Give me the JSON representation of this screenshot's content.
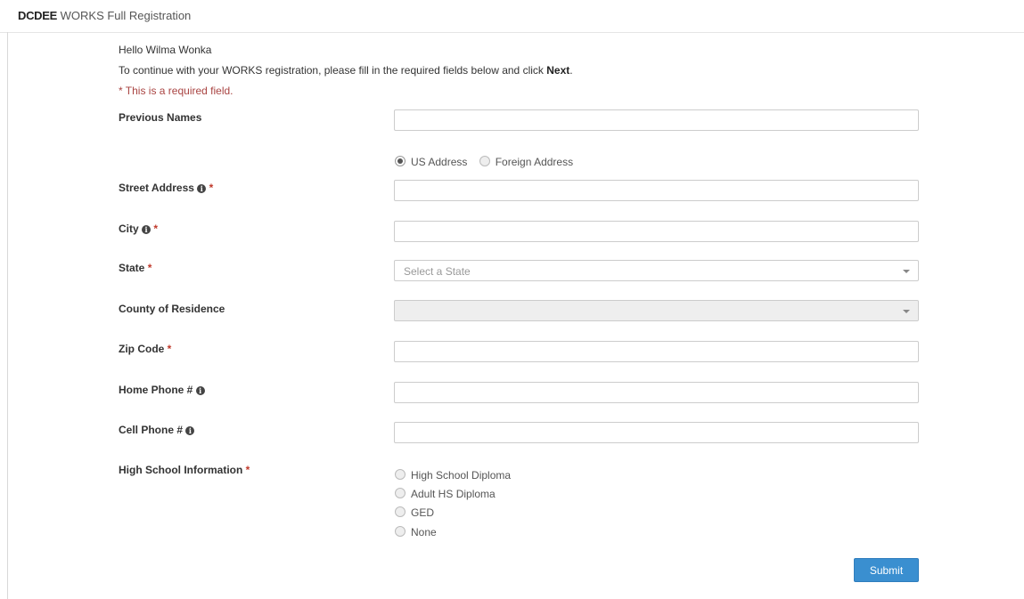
{
  "header": {
    "brand": "DCDEE",
    "title_rest": " WORKS Full Registration"
  },
  "intro": {
    "greeting": "Hello Wilma Wonka",
    "instructions_prefix": "To continue with your WORKS registration, please fill in the required fields below and click ",
    "instructions_bold": "Next",
    "instructions_suffix": ".",
    "required_note": "* This is a required field."
  },
  "fields": {
    "previous_names": {
      "label": "Previous Names",
      "value": ""
    },
    "address_type": {
      "options": [
        "US Address",
        "Foreign Address"
      ],
      "selected": "US Address"
    },
    "street_address": {
      "label": "Street Address",
      "value": ""
    },
    "city": {
      "label": "City",
      "value": ""
    },
    "state": {
      "label": "State",
      "placeholder": "Select a State"
    },
    "county": {
      "label": "County of Residence",
      "value": ""
    },
    "zip": {
      "label": "Zip Code",
      "value": ""
    },
    "home_phone": {
      "label": "Home Phone #",
      "value": ""
    },
    "cell_phone": {
      "label": "Cell Phone #",
      "value": ""
    },
    "high_school": {
      "label": "High School Information",
      "options": [
        "High School Diploma",
        "Adult HS Diploma",
        "GED",
        "None"
      ],
      "selected": null
    }
  },
  "required_marker": "*",
  "info_icon_glyph": "i",
  "submit_label": "Submit",
  "colors": {
    "required": "#c0392b",
    "required_note": "#a94442",
    "primary_button": "#3a8fd0"
  },
  "icons": {
    "info": "info-circle-icon",
    "dropdown": "caret-down-icon"
  }
}
